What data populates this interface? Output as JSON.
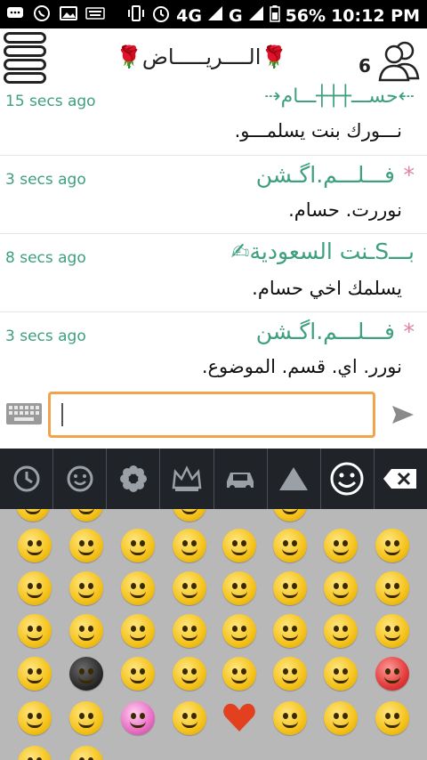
{
  "status": {
    "battery": "56%",
    "time": "10:12 PM",
    "network": "4G",
    "network2": "G",
    "network_super": "4G"
  },
  "header": {
    "title": "🌹الــــريـــــاض🌹",
    "users_count": "6"
  },
  "messages": [
    {
      "time": "15 secs ago",
      "name": "⇠حســـ┼┼┼ـــام⇢",
      "text": "نـــورك بنت يسلمـــو."
    },
    {
      "time": "3 secs ago",
      "name": "فـــلـــم.اگـشن",
      "star": "*",
      "text": "نوررت. حسام."
    },
    {
      "time": "8 secs ago",
      "name": "بـــSـنت السعودية✍",
      "text": "يسلمك اخي حسام."
    },
    {
      "time": "3 secs ago",
      "name": "فـــلـــم.اگـشن",
      "star": "*",
      "text": "نورر. اي. قسم. الموضوع."
    }
  ],
  "input": {
    "value": "",
    "placeholder": ""
  },
  "emoji_tabs": [
    "recent",
    "smiley-outline",
    "flower",
    "crown",
    "car",
    "triangle",
    "smiley-active",
    "backspace"
  ],
  "active_tab": "smiley-active"
}
